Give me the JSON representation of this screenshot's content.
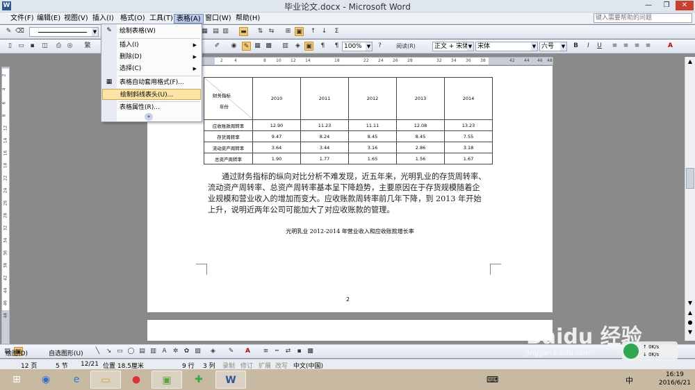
{
  "window": {
    "title": "毕业论文.docx - Microsoft Word",
    "help_placeholder": "键入需要帮助的问题"
  },
  "menubar": {
    "items": [
      "文件(F)",
      "编辑(E)",
      "视图(V)",
      "插入(I)",
      "格式(O)",
      "工具(T)",
      "表格(A)",
      "窗口(W)",
      "帮助(H)"
    ],
    "active": "表格(A)"
  },
  "toolbar_format": {
    "zoom": "100%",
    "reading": "阅读(R)",
    "style": "正文 + 宋体",
    "font": "宋体",
    "size": "六号",
    "bold": "B",
    "italic": "I",
    "underline": "U",
    "text_color": "A"
  },
  "table_menu": {
    "items": [
      {
        "label": "绘制表格(W)",
        "has_sub": false
      },
      {
        "label": "插入(I)",
        "has_sub": true
      },
      {
        "label": "删除(D)",
        "has_sub": true
      },
      {
        "label": "选择(C)",
        "has_sub": true
      },
      {
        "label": "表格自动套用格式(F)...",
        "has_sub": false
      },
      {
        "label": "绘制斜线表头(U)...",
        "has_sub": false,
        "highlighted": true
      },
      {
        "label": "表格属性(R)...",
        "has_sub": false
      }
    ],
    "expand_icon": "chevron-double-down-icon"
  },
  "ruler": {
    "ticks": [
      "2",
      "4",
      "8",
      "10",
      "12",
      "14",
      "18",
      "22",
      "24",
      "26",
      "28",
      "32",
      "34",
      "36",
      "38",
      "42",
      "44",
      "46",
      "48"
    ],
    "vticks": [
      "2",
      "4",
      "6",
      "8",
      "12",
      "14",
      "16",
      "18",
      "22",
      "24",
      "26",
      "28",
      "32",
      "34",
      "36",
      "38",
      "42",
      "44",
      "46",
      "48"
    ]
  },
  "document": {
    "table": {
      "header_top": "财务指标",
      "header_bottom": "年份",
      "years": [
        "2010",
        "2011",
        "2012",
        "2013",
        "2014"
      ],
      "rows": [
        {
          "name": "应收账款周转率",
          "values": [
            "12.90",
            "11.23",
            "11.11",
            "12.08",
            "13.23"
          ]
        },
        {
          "name": "存货周转率",
          "values": [
            "9.47",
            "8.24",
            "8.45",
            "8.45",
            "7.55"
          ]
        },
        {
          "name": "流动资产周转率",
          "values": [
            "3.64",
            "3.44",
            "3.16",
            "2.86",
            "3.18"
          ]
        },
        {
          "name": "总资产周转率",
          "values": [
            "1.90",
            "1.77",
            "1.65",
            "1.56",
            "1.67"
          ]
        }
      ]
    },
    "paragraph_lines": [
      "通过财务指标的纵向对比分析不难发现，近五年来，光明乳业的存货周转率、",
      "流动资产周转率、总资产周转率基本呈下降趋势，主要原因在于存货规模随着企",
      "业规模和营业收入的增加而变大。应收账款周转率前几年下降，到 2013 年开始",
      "上升，说明近两年公司可能加大了对应收账款的管理。"
    ],
    "caption": "光明乳业 2012-2014 年营业收入和应收账款增长率",
    "page_number": "2"
  },
  "drawbar": {
    "draw": "绘图(D)",
    "autoshapes": "自选图形(U)"
  },
  "status": {
    "page": "12 页",
    "section": "5 节",
    "pages": "12/21",
    "position": "位置 18.5厘米",
    "line": "9 行",
    "col": "3 列",
    "rec": "录制",
    "trk": "修订",
    "ext": "扩展",
    "ovr": "改写",
    "lang": "中文(中国)"
  },
  "taskbar": {
    "time": "16:19",
    "date": "2016/6/21",
    "ime": "中",
    "speed_up": "0K/s",
    "speed_down": "0K/s",
    "watermark": "Baidu 经验",
    "watermark_url": "jingyan.baidu.com"
  }
}
